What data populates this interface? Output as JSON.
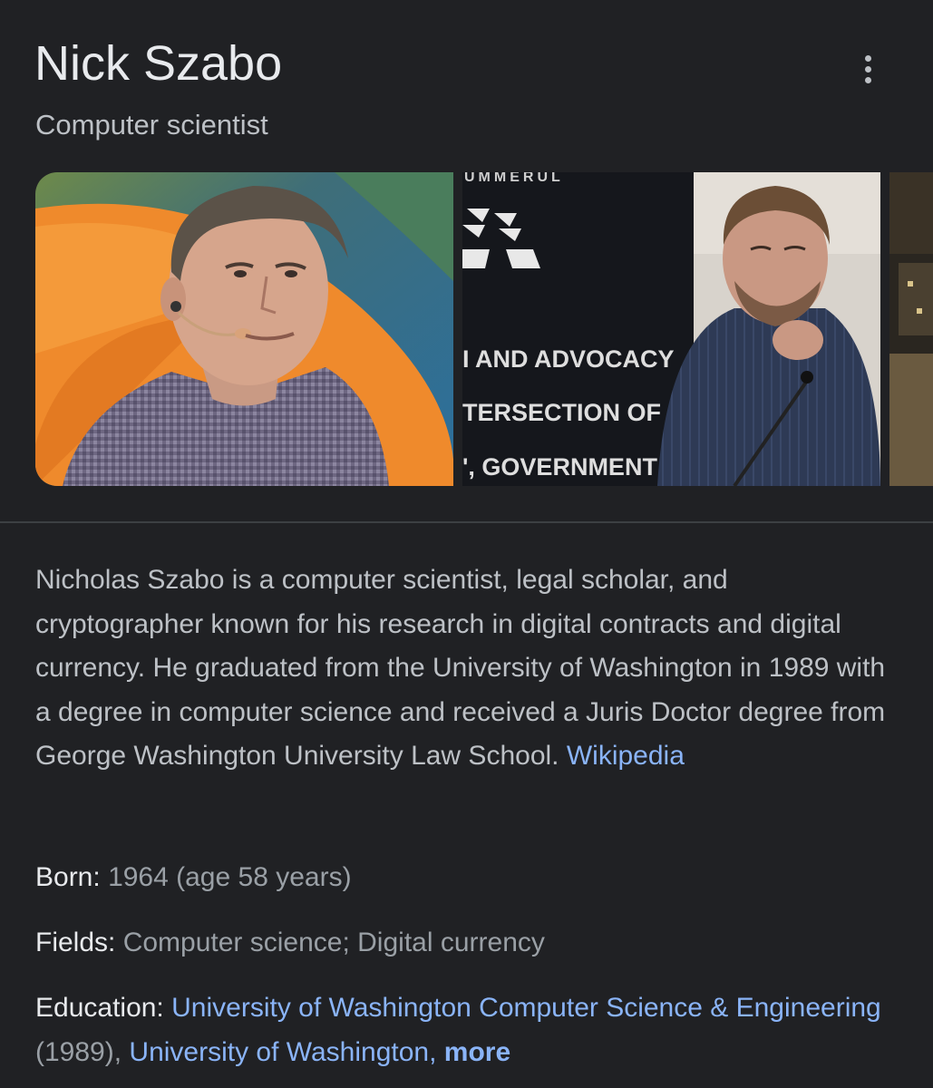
{
  "header": {
    "title": "Nick Szabo",
    "subtitle": "Computer scientist",
    "more_options_icon": "more-vert-icon"
  },
  "images": {
    "photo_2_sign_lines": [
      "I AND ADVOCACY",
      "TERSECTION OF",
      "', GOVERNMENT"
    ]
  },
  "description": {
    "text": "Nicholas Szabo is a computer scientist, legal scholar, and cryptographer known for his research in digital contracts and digital currency. He graduated from the University of Washington in 1989 with a degree in computer science and received a Juris Doctor degree from George Washington University Law School.",
    "source_link": "Wikipedia"
  },
  "facts": {
    "born": {
      "label": "Born:",
      "value": "1964 (age 58 years)"
    },
    "fields": {
      "label": "Fields:",
      "value": "Computer science; Digital currency"
    },
    "education": {
      "label": "Education:",
      "link1": "University of Washington Computer Science & Engineering",
      "year1": "(1989),",
      "link2": "University of Washington,",
      "more": "more"
    }
  },
  "colors": {
    "background": "#202124",
    "primary_text": "#e8eaed",
    "secondary_text": "#bdc1c6",
    "link": "#8ab4f8",
    "divider": "#3c4043"
  }
}
